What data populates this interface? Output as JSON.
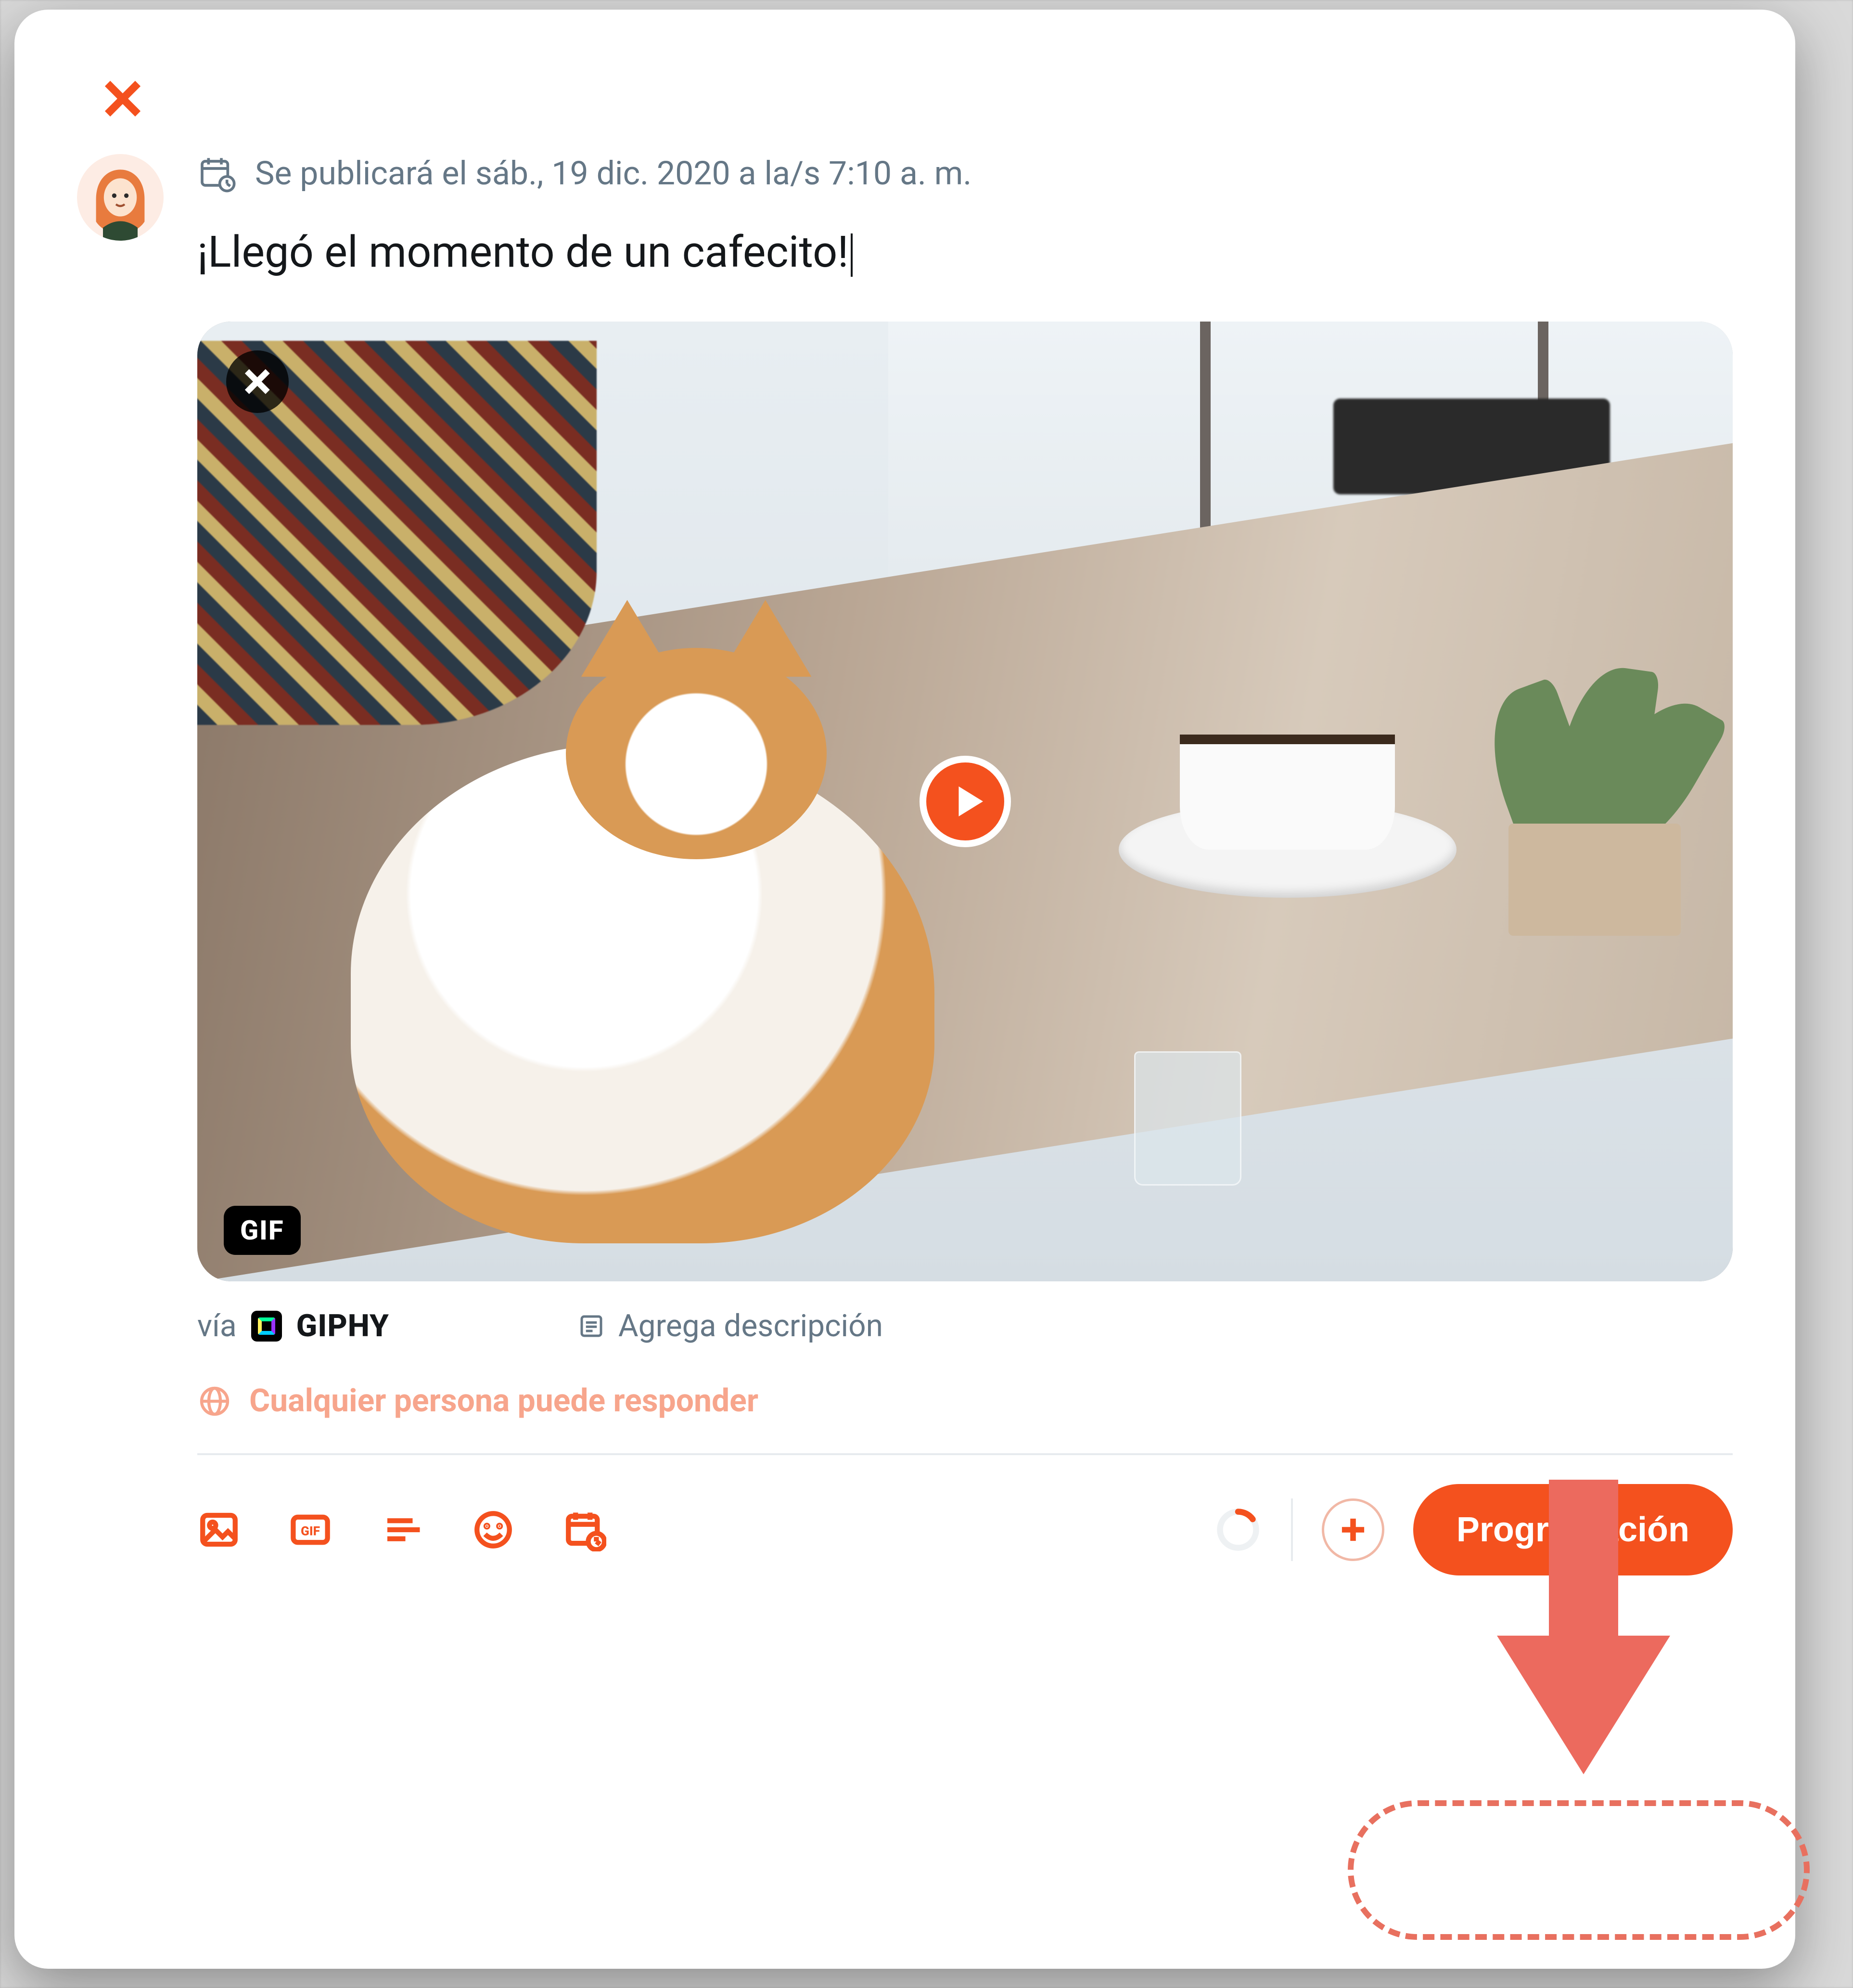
{
  "colors": {
    "accent": "#f4511e",
    "muted": "#657786",
    "text": "#14171a",
    "annotation": "#ec6a5e"
  },
  "modal": {
    "schedule_line": "Se publicará el sáb., 19 dic. 2020 a la/s 7:10 a. m.",
    "compose_text": "¡Llegó el momento de un cafecito!",
    "media": {
      "badge": "GIF",
      "via_prefix": "vía",
      "provider": "GIPHY",
      "add_description": "Agrega descripción"
    },
    "reply_setting": "Cualquier persona puede responder",
    "toolbar": {
      "gif_label": "GIF",
      "submit_label": "Programación"
    }
  }
}
